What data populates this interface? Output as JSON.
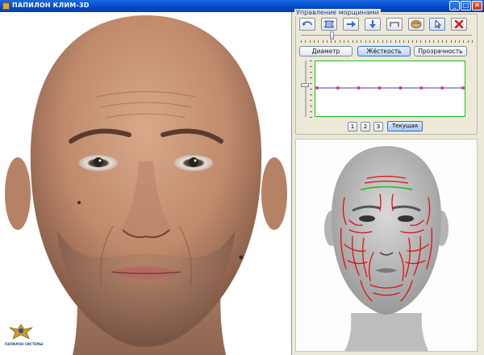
{
  "window": {
    "title": "ПАПИЛОН КЛИМ-3D",
    "minimize_label": "_",
    "maximize_label": "□",
    "close_label": "✕"
  },
  "wrinkle_panel": {
    "title": "Управление морщинами",
    "toolbar": [
      {
        "icon": "rotate-icon"
      },
      {
        "icon": "fit-view-icon"
      },
      {
        "icon": "arrow-right-icon"
      },
      {
        "icon": "arrow-down-icon"
      },
      {
        "icon": "bracket-icon"
      },
      {
        "icon": "palette-icon"
      },
      {
        "icon": "cursor-icon",
        "selected": true
      },
      {
        "icon": "delete-icon"
      }
    ],
    "tabs": [
      "Диаметр",
      "Жёсткость",
      "Прозрачность"
    ],
    "active_tab": "Жёсткость",
    "presets": [
      "1",
      "2",
      "3"
    ],
    "current_button": "Текущая",
    "curve_points": 8
  },
  "logo": {
    "text": "ПАПИЛОН СИСТЕМЫ"
  },
  "colors": {
    "titlebar": "#0a4fd0",
    "curve_border": "#19c219",
    "curve_line": "#3a3ad0",
    "curve_points": "#d0408a",
    "wrinkle_lines": "#e01010",
    "forehead_line": "#21b821"
  }
}
